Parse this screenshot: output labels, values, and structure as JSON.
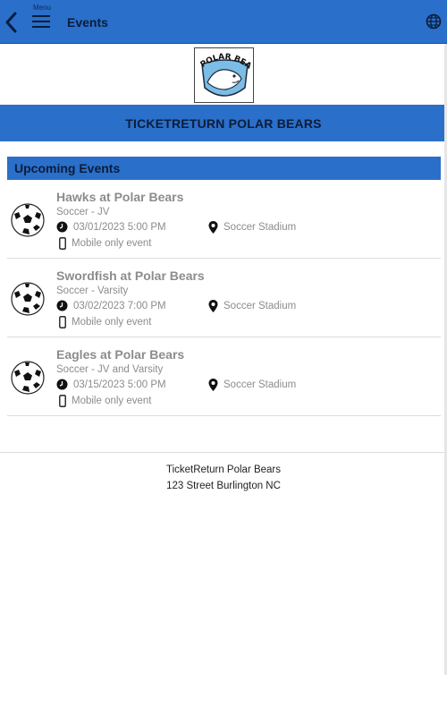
{
  "topbar": {
    "menu_label": "Menu",
    "title": "Events",
    "icons": {
      "back": "chevron-left-icon",
      "menu": "hamburger-icon",
      "language": "globe-icon"
    }
  },
  "logo": {
    "text": "TR POLAR BEARS"
  },
  "banner": {
    "title": "TICKETRETURN POLAR BEARS"
  },
  "events_section": {
    "heading": "Upcoming Events",
    "events": [
      {
        "title": "Hawks at Polar Bears",
        "subtitle": "Soccer - JV",
        "datetime": "03/01/2023 5:00 PM",
        "venue": "Soccer Stadium",
        "note": "Mobile only event"
      },
      {
        "title": "Swordfish at Polar Bears",
        "subtitle": "Soccer - Varsity",
        "datetime": "03/02/2023 7:00 PM",
        "venue": "Soccer Stadium",
        "note": "Mobile only event"
      },
      {
        "title": "Eagles at Polar Bears",
        "subtitle": "Soccer - JV and Varsity",
        "datetime": "03/15/2023 5:00 PM",
        "venue": "Soccer Stadium",
        "note": "Mobile only event"
      }
    ]
  },
  "footer": {
    "line1": "TicketReturn Polar Bears",
    "line2": "123 Street Burlington NC"
  },
  "colors": {
    "accent": "#2a6fc9",
    "muted_text": "#8c8c8c",
    "dark_text": "#0b1d3a"
  }
}
